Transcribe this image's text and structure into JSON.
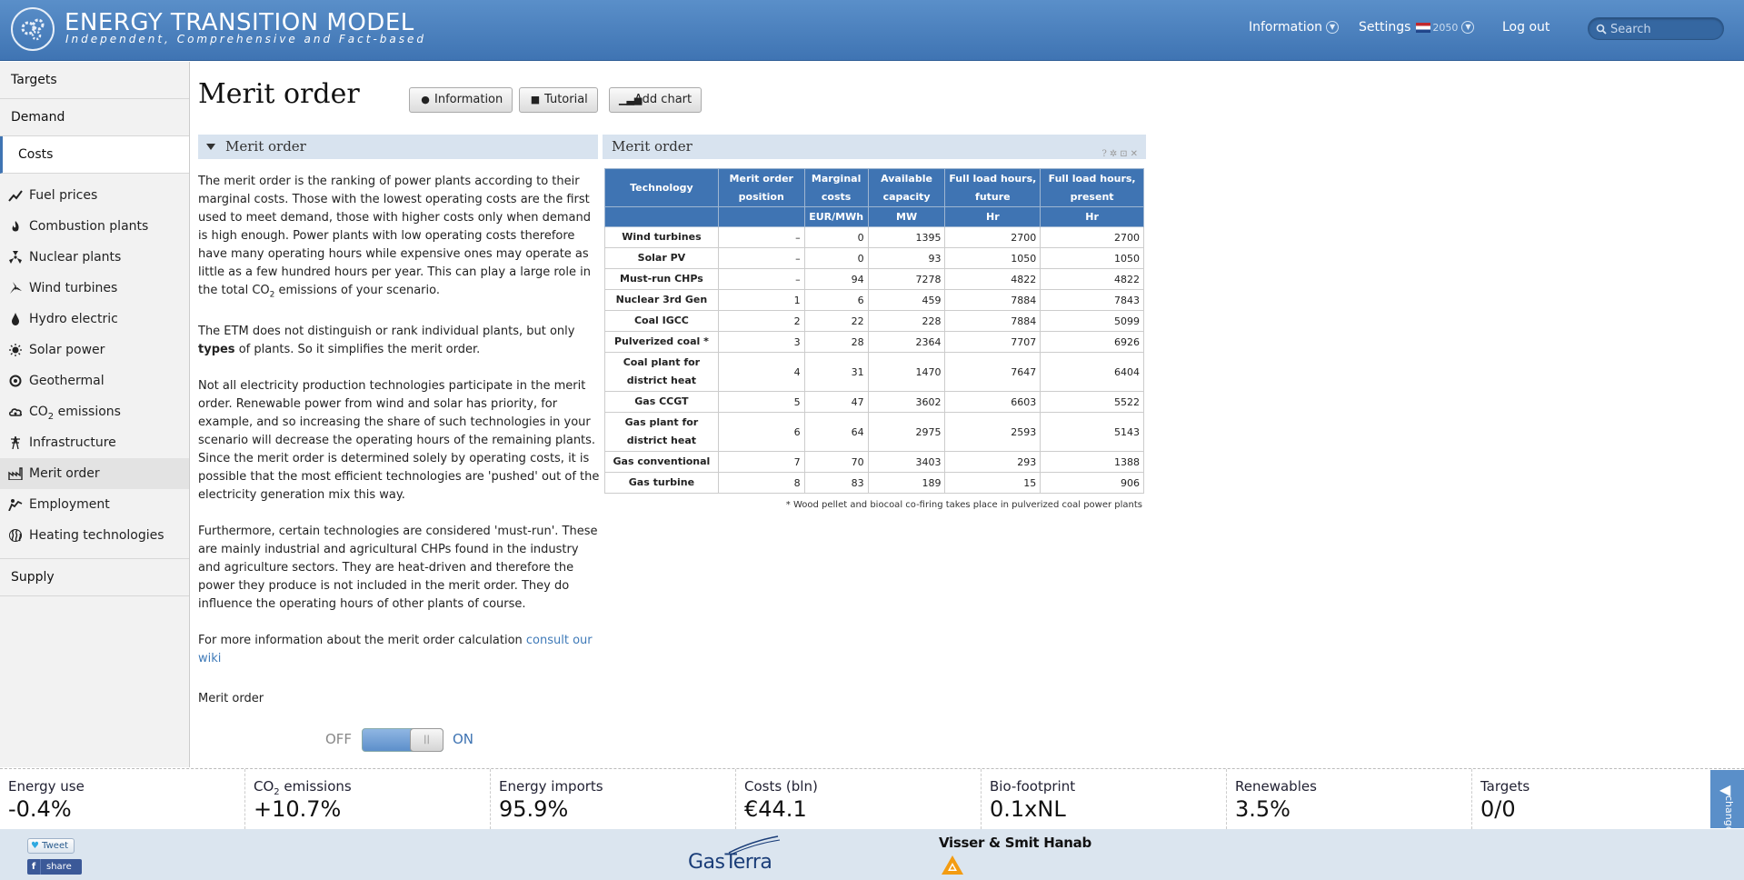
{
  "header": {
    "brand_title": "ENERGY TRANSITION MODEL",
    "brand_subtitle": "Independent, Comprehensive and Fact-based",
    "nav_information": "Information",
    "nav_settings": "Settings",
    "nav_year": "2050",
    "nav_logout": "Log out",
    "search_placeholder": "Search"
  },
  "sidebar": {
    "top_items": [
      {
        "label": "Targets"
      },
      {
        "label": "Demand"
      },
      {
        "label": "Costs"
      }
    ],
    "sub_items": [
      {
        "label": "Fuel prices",
        "icon": "chart-line-icon"
      },
      {
        "label": "Combustion plants",
        "icon": "flame-icon"
      },
      {
        "label": "Nuclear plants",
        "icon": "radiation-icon"
      },
      {
        "label": "Wind turbines",
        "icon": "wind-turbine-icon"
      },
      {
        "label": "Hydro electric",
        "icon": "water-drop-icon"
      },
      {
        "label": "Solar power",
        "icon": "sun-icon"
      },
      {
        "label": "Geothermal",
        "icon": "geothermal-icon"
      },
      {
        "label": "CO",
        "label_sub": "2",
        "label_after": " emissions",
        "icon": "cloud-icon"
      },
      {
        "label": "Infrastructure",
        "icon": "pylon-icon"
      },
      {
        "label": "Merit order",
        "icon": "factory-icon"
      },
      {
        "label": "Employment",
        "icon": "person-chart-icon"
      },
      {
        "label": "Heating technologies",
        "icon": "heat-icon"
      }
    ],
    "bottom_item": "Supply"
  },
  "main": {
    "title": "Merit order",
    "buttons": {
      "information": "Information",
      "tutorial": "Tutorial",
      "add_chart": "Add chart"
    },
    "left_panel_title": "Merit order",
    "right_panel_title": "Merit order",
    "paragraphs": {
      "p1_a": "The merit order is the ranking of power plants according to their marginal costs. Those with the lowest operating costs are the first used to meet demand, those with higher costs only when demand is high enough. Power plants with low operating costs therefore have many operating hours while expensive ones may operate as little as a few hundred hours per year. This can play a large role in the total CO",
      "p1_sub": "2",
      "p1_b": " emissions of your scenario.",
      "p2_a": "The ETM does not distinguish or rank individual plants, but only ",
      "p2_bold": "types",
      "p2_b": " of plants. So it simplifies the merit order.",
      "p3": "Not all electricity production technologies participate in the merit order. Renewable power from wind and solar has priority, for example, and so increasing the share of such technologies in your scenario will decrease the operating hours of the remaining plants. Since the merit order is determined solely by operating costs, it is possible that the most efficient technologies are 'pushed' out of the electricity generation mix this way.",
      "p4": "Furthermore, certain technologies are considered 'must-run'. These are mainly industrial and agricultural CHPs found in the industry and agriculture sectors. They are heat-driven and therefore the power they produce is not included in the merit order. They do influence the operating hours of other plants of course.",
      "p5": "For more information about the merit order calculation ",
      "p5_link": "consult our wiki"
    },
    "toggle": {
      "label": "Merit order",
      "off": "OFF",
      "on": "ON",
      "knob": "||",
      "state": "on"
    }
  },
  "table": {
    "headers": [
      "Technology",
      "Merit order position",
      "Marginal costs",
      "Available capacity",
      "Full load hours, future",
      "Full load hours, present"
    ],
    "units": [
      "",
      "",
      "EUR/MWh",
      "MW",
      "Hr",
      "Hr"
    ],
    "rows": [
      [
        "Wind turbines",
        "–",
        "0",
        "1395",
        "2700",
        "2700"
      ],
      [
        "Solar PV",
        "–",
        "0",
        "93",
        "1050",
        "1050"
      ],
      [
        "Must-run CHPs",
        "–",
        "94",
        "7278",
        "4822",
        "4822"
      ],
      [
        "Nuclear 3rd Gen",
        "1",
        "6",
        "459",
        "7884",
        "7843"
      ],
      [
        "Coal IGCC",
        "2",
        "22",
        "228",
        "7884",
        "5099"
      ],
      [
        "Pulverized coal *",
        "3",
        "28",
        "2364",
        "7707",
        "6926"
      ],
      [
        "Coal plant for district heat",
        "4",
        "31",
        "1470",
        "7647",
        "6404"
      ],
      [
        "Gas CCGT",
        "5",
        "47",
        "3602",
        "6603",
        "5522"
      ],
      [
        "Gas plant for district heat",
        "6",
        "64",
        "2975",
        "2593",
        "5143"
      ],
      [
        "Gas conventional",
        "7",
        "70",
        "3403",
        "293",
        "1388"
      ],
      [
        "Gas turbine",
        "8",
        "83",
        "189",
        "15",
        "906"
      ]
    ],
    "footnote": "* Wood pellet and biocoal co-firing takes place in pulverized coal power plants"
  },
  "dashboard": [
    {
      "label": "Energy use",
      "value": "-0.4%"
    },
    {
      "label": "CO",
      "label_sub": "2",
      "label_after": " emissions",
      "value": "+10.7%"
    },
    {
      "label": "Energy imports",
      "value": "95.9%"
    },
    {
      "label": "Costs (bln)",
      "value": "€44.1"
    },
    {
      "label": "Bio-footprint",
      "value": "0.1xNL"
    },
    {
      "label": "Renewables",
      "value": "3.5%"
    },
    {
      "label": "Targets",
      "value": "0/0"
    }
  ],
  "change_button": "change",
  "footer": {
    "tweet": "Tweet",
    "share": "share",
    "sponsor1": "GasTerra",
    "sponsor2": "Visser & Smit Hanab"
  },
  "colors": {
    "header_blue": "#4a80bf",
    "accent": "#3f74b3",
    "table_header": "#3f74b3",
    "footer_bg": "#dbe5ef"
  }
}
